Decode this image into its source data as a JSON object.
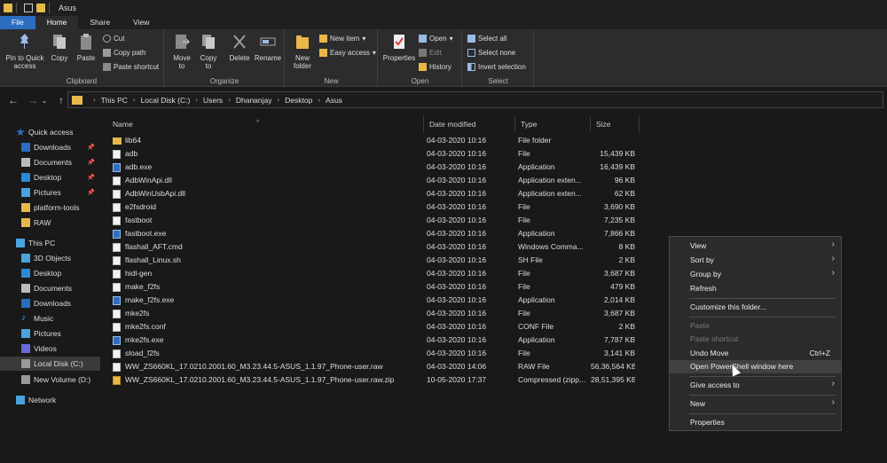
{
  "window": {
    "title": "Asus"
  },
  "ribbon_tabs": [
    "File",
    "Home",
    "Share",
    "View"
  ],
  "clipboard": {
    "pin_label": "Pin to Quick access",
    "copy_label": "Copy",
    "paste_label": "Paste",
    "cut_label": "Cut",
    "copy_path_label": "Copy path",
    "paste_shortcut_label": "Paste shortcut",
    "group_label": "Clipboard"
  },
  "organize": {
    "move_label": "Move to",
    "copy_label": "Copy to",
    "delete_label": "Delete",
    "rename_label": "Rename",
    "group_label": "Organize"
  },
  "new_group": {
    "new_folder_label": "New folder",
    "new_item_label": "New item",
    "easy_access_label": "Easy access",
    "group_label": "New"
  },
  "open_group": {
    "properties_label": "Properties",
    "open_label": "Open",
    "edit_label": "Edit",
    "history_label": "History",
    "group_label": "Open"
  },
  "select_group": {
    "select_all_label": "Select all",
    "select_none_label": "Select none",
    "invert_label": "Invert selection",
    "group_label": "Select"
  },
  "breadcrumbs": [
    "This PC",
    "Local Disk (C:)",
    "Users",
    "Dhananjay",
    "Desktop",
    "Asus"
  ],
  "nav_pane": {
    "quick_access": "Quick access",
    "quick_items": [
      "Downloads",
      "Documents",
      "Desktop",
      "Pictures",
      "platform-tools",
      "RAW"
    ],
    "this_pc": "This PC",
    "pc_items": [
      "3D Objects",
      "Desktop",
      "Documents",
      "Downloads",
      "Music",
      "Pictures",
      "Videos",
      "Local Disk (C:)",
      "New Volume (D:)"
    ],
    "network": "Network"
  },
  "columns": {
    "name": "Name",
    "date": "Date modified",
    "type": "Type",
    "size": "Size"
  },
  "files": [
    {
      "name": "lib64",
      "date": "04-03-2020 10:16",
      "type": "File folder",
      "size": "",
      "icon": "folder"
    },
    {
      "name": "adb",
      "date": "04-03-2020 10:16",
      "type": "File",
      "size": "15,439 KB",
      "icon": "file"
    },
    {
      "name": "adb.exe",
      "date": "04-03-2020 10:16",
      "type": "Application",
      "size": "16,439 KB",
      "icon": "app"
    },
    {
      "name": "AdbWinApi.dll",
      "date": "04-03-2020 10:16",
      "type": "Application exten...",
      "size": "96 KB",
      "icon": "file"
    },
    {
      "name": "AdbWinUsbApi.dll",
      "date": "04-03-2020 10:16",
      "type": "Application exten...",
      "size": "62 KB",
      "icon": "file"
    },
    {
      "name": "e2fsdroid",
      "date": "04-03-2020 10:16",
      "type": "File",
      "size": "3,690 KB",
      "icon": "file"
    },
    {
      "name": "fastboot",
      "date": "04-03-2020 10:16",
      "type": "File",
      "size": "7,235 KB",
      "icon": "file"
    },
    {
      "name": "fastboot.exe",
      "date": "04-03-2020 10:16",
      "type": "Application",
      "size": "7,866 KB",
      "icon": "app"
    },
    {
      "name": "flashall_AFT.cmd",
      "date": "04-03-2020 10:16",
      "type": "Windows Comma...",
      "size": "8 KB",
      "icon": "file"
    },
    {
      "name": "flashall_Linux.sh",
      "date": "04-03-2020 10:16",
      "type": "SH File",
      "size": "2 KB",
      "icon": "file"
    },
    {
      "name": "hidl-gen",
      "date": "04-03-2020 10:16",
      "type": "File",
      "size": "3,687 KB",
      "icon": "file"
    },
    {
      "name": "make_f2fs",
      "date": "04-03-2020 10:16",
      "type": "File",
      "size": "479 KB",
      "icon": "file"
    },
    {
      "name": "make_f2fs.exe",
      "date": "04-03-2020 10:16",
      "type": "Application",
      "size": "2,014 KB",
      "icon": "app"
    },
    {
      "name": "mke2fs",
      "date": "04-03-2020 10:16",
      "type": "File",
      "size": "3,687 KB",
      "icon": "file"
    },
    {
      "name": "mke2fs.conf",
      "date": "04-03-2020 10:16",
      "type": "CONF File",
      "size": "2 KB",
      "icon": "file"
    },
    {
      "name": "mke2fs.exe",
      "date": "04-03-2020 10:16",
      "type": "Application",
      "size": "7,787 KB",
      "icon": "app"
    },
    {
      "name": "sload_f2fs",
      "date": "04-03-2020 10:16",
      "type": "File",
      "size": "3,141 KB",
      "icon": "file"
    },
    {
      "name": "WW_ZS660KL_17.0210.2001.60_M3.23.44.5-ASUS_1.1.97_Phone-user.raw",
      "date": "04-03-2020 14:06",
      "type": "RAW File",
      "size": "56,36,564 KB",
      "icon": "file"
    },
    {
      "name": "WW_ZS660KL_17.0210.2001.60_M3.23.44.5-ASUS_1.1.97_Phone-user.raw.zip",
      "date": "10-05-2020 17:37",
      "type": "Compressed (zipp...",
      "size": "28,51,395 KB",
      "icon": "zip"
    }
  ],
  "context_menu": {
    "view": "View",
    "sort_by": "Sort by",
    "group_by": "Group by",
    "refresh": "Refresh",
    "customize": "Customize this folder...",
    "paste": "Paste",
    "paste_shortcut": "Paste shortcut",
    "undo_move": "Undo Move",
    "undo_shortcut": "Ctrl+Z",
    "open_powershell": "Open PowerShell window here",
    "give_access": "Give access to",
    "new": "New",
    "properties": "Properties"
  }
}
